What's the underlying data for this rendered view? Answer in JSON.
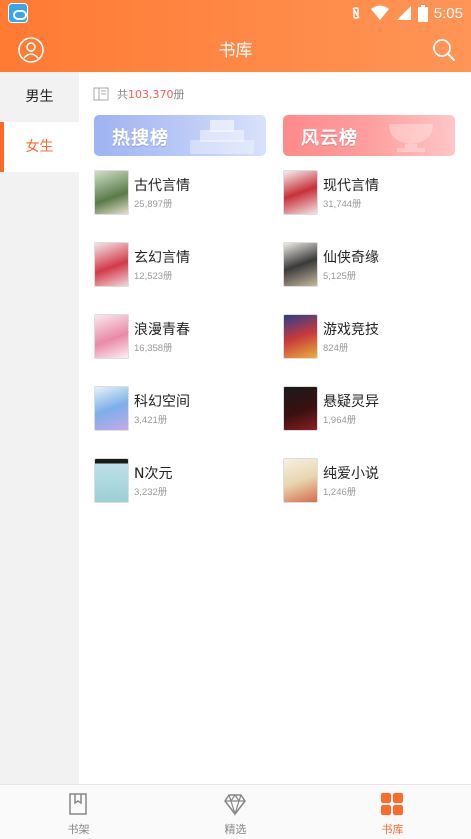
{
  "status_bar": {
    "time": "5:05"
  },
  "header": {
    "title": "书库"
  },
  "sidebar": {
    "items": [
      {
        "label": "男生",
        "active": false
      },
      {
        "label": "女生",
        "active": true
      }
    ]
  },
  "main": {
    "total_prefix": "共",
    "total_count": "103,370",
    "total_suffix": "册",
    "banners": [
      {
        "label": "热搜榜"
      },
      {
        "label": "风云榜"
      }
    ],
    "categories": [
      {
        "name": "古代言情",
        "count": "25,897册"
      },
      {
        "name": "现代言情",
        "count": "31,744册"
      },
      {
        "name": "玄幻言情",
        "count": "12,523册"
      },
      {
        "name": "仙侠奇缘",
        "count": "5,125册"
      },
      {
        "name": "浪漫青春",
        "count": "16,358册"
      },
      {
        "name": "游戏竞技",
        "count": "824册"
      },
      {
        "name": "科幻空间",
        "count": "3,421册"
      },
      {
        "name": "悬疑灵异",
        "count": "1,964册"
      },
      {
        "name": "N次元",
        "count": "3,232册"
      },
      {
        "name": "纯爱小说",
        "count": "1,246册"
      }
    ]
  },
  "bottom_nav": {
    "items": [
      {
        "label": "书架",
        "icon": "bookmark-icon"
      },
      {
        "label": "精选",
        "icon": "diamond-icon"
      },
      {
        "label": "书库",
        "icon": "grid-icon",
        "active": true
      }
    ]
  },
  "colors": {
    "accent": "#ff6a2b",
    "count_highlight": "#ff5a4f",
    "hot_banner": "#a9bdf4",
    "wind_banner": "#ff9a9a"
  }
}
